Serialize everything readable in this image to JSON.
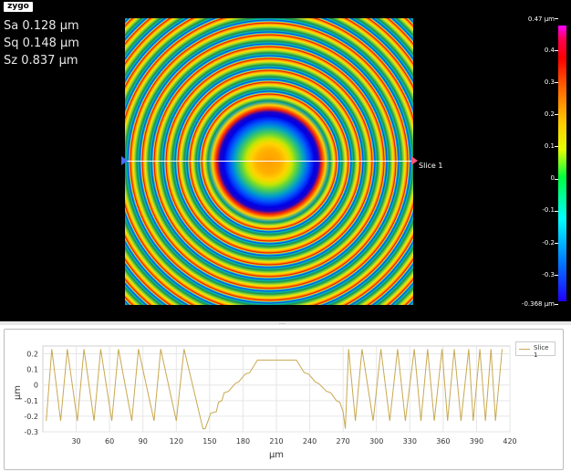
{
  "app": {
    "logo": "zygo"
  },
  "stats": [
    {
      "label": "Sa",
      "value": "0.128 µm"
    },
    {
      "label": "Sq",
      "value": "0.148 µm"
    },
    {
      "label": "Sz",
      "value": "0.837 µm"
    }
  ],
  "map": {
    "slice_label": "Slice 1"
  },
  "colorbar": {
    "labels": [
      "0.47 µm",
      "0.4",
      "0.3",
      "0.2",
      "0.1",
      "0",
      "-0.1",
      "-0.2",
      "-0.3",
      "-0.368 µm"
    ],
    "max": 0.47,
    "min": -0.368
  },
  "chart_data": {
    "type": "line",
    "title": "",
    "xlabel": "µm",
    "ylabel": "µm",
    "xlim": [
      0,
      420
    ],
    "ylim": [
      -0.3,
      0.25
    ],
    "xticks": [
      30,
      60,
      90,
      120,
      150,
      180,
      210,
      240,
      270,
      300,
      330,
      360,
      390,
      420
    ],
    "yticks": [
      0.2,
      0.1,
      0,
      -0.1,
      -0.2,
      -0.3
    ],
    "ytick_labels": [
      "0.2",
      "0.1",
      "0",
      "-0.1",
      "-0.2",
      "-0.3"
    ],
    "grid": true,
    "legend_position": "top-right",
    "series": [
      {
        "name": "Slice 1",
        "color": "#c8a850",
        "x": [
          3,
          8,
          16,
          22,
          31,
          37,
          46,
          52,
          62,
          68,
          80,
          86,
          100,
          106,
          120,
          127,
          144,
          146,
          151,
          156,
          158,
          161,
          163,
          167,
          173,
          176,
          182,
          186,
          193,
          228,
          235,
          239,
          245,
          248,
          255,
          259,
          264,
          267,
          270,
          272,
          275,
          281,
          287,
          297,
          304,
          312,
          319,
          326,
          334,
          340,
          346,
          352,
          359,
          364,
          370,
          376,
          383,
          387,
          393,
          398,
          403,
          407,
          413
        ],
        "y": [
          -0.23,
          0.23,
          -0.23,
          0.23,
          -0.23,
          0.23,
          -0.23,
          0.23,
          -0.23,
          0.23,
          -0.23,
          0.23,
          -0.23,
          0.23,
          -0.23,
          0.23,
          -0.28,
          -0.28,
          -0.18,
          -0.17,
          -0.11,
          -0.1,
          -0.05,
          -0.04,
          0.01,
          0.02,
          0.07,
          0.08,
          0.16,
          0.16,
          0.08,
          0.07,
          0.02,
          0.01,
          -0.04,
          -0.05,
          -0.1,
          -0.11,
          -0.17,
          -0.28,
          0.23,
          -0.23,
          0.23,
          -0.23,
          0.23,
          -0.23,
          0.23,
          -0.23,
          0.23,
          -0.23,
          0.23,
          -0.23,
          0.23,
          -0.23,
          0.23,
          -0.23,
          0.23,
          -0.23,
          0.23,
          -0.23,
          0.23,
          -0.23,
          0.23
        ]
      }
    ]
  }
}
